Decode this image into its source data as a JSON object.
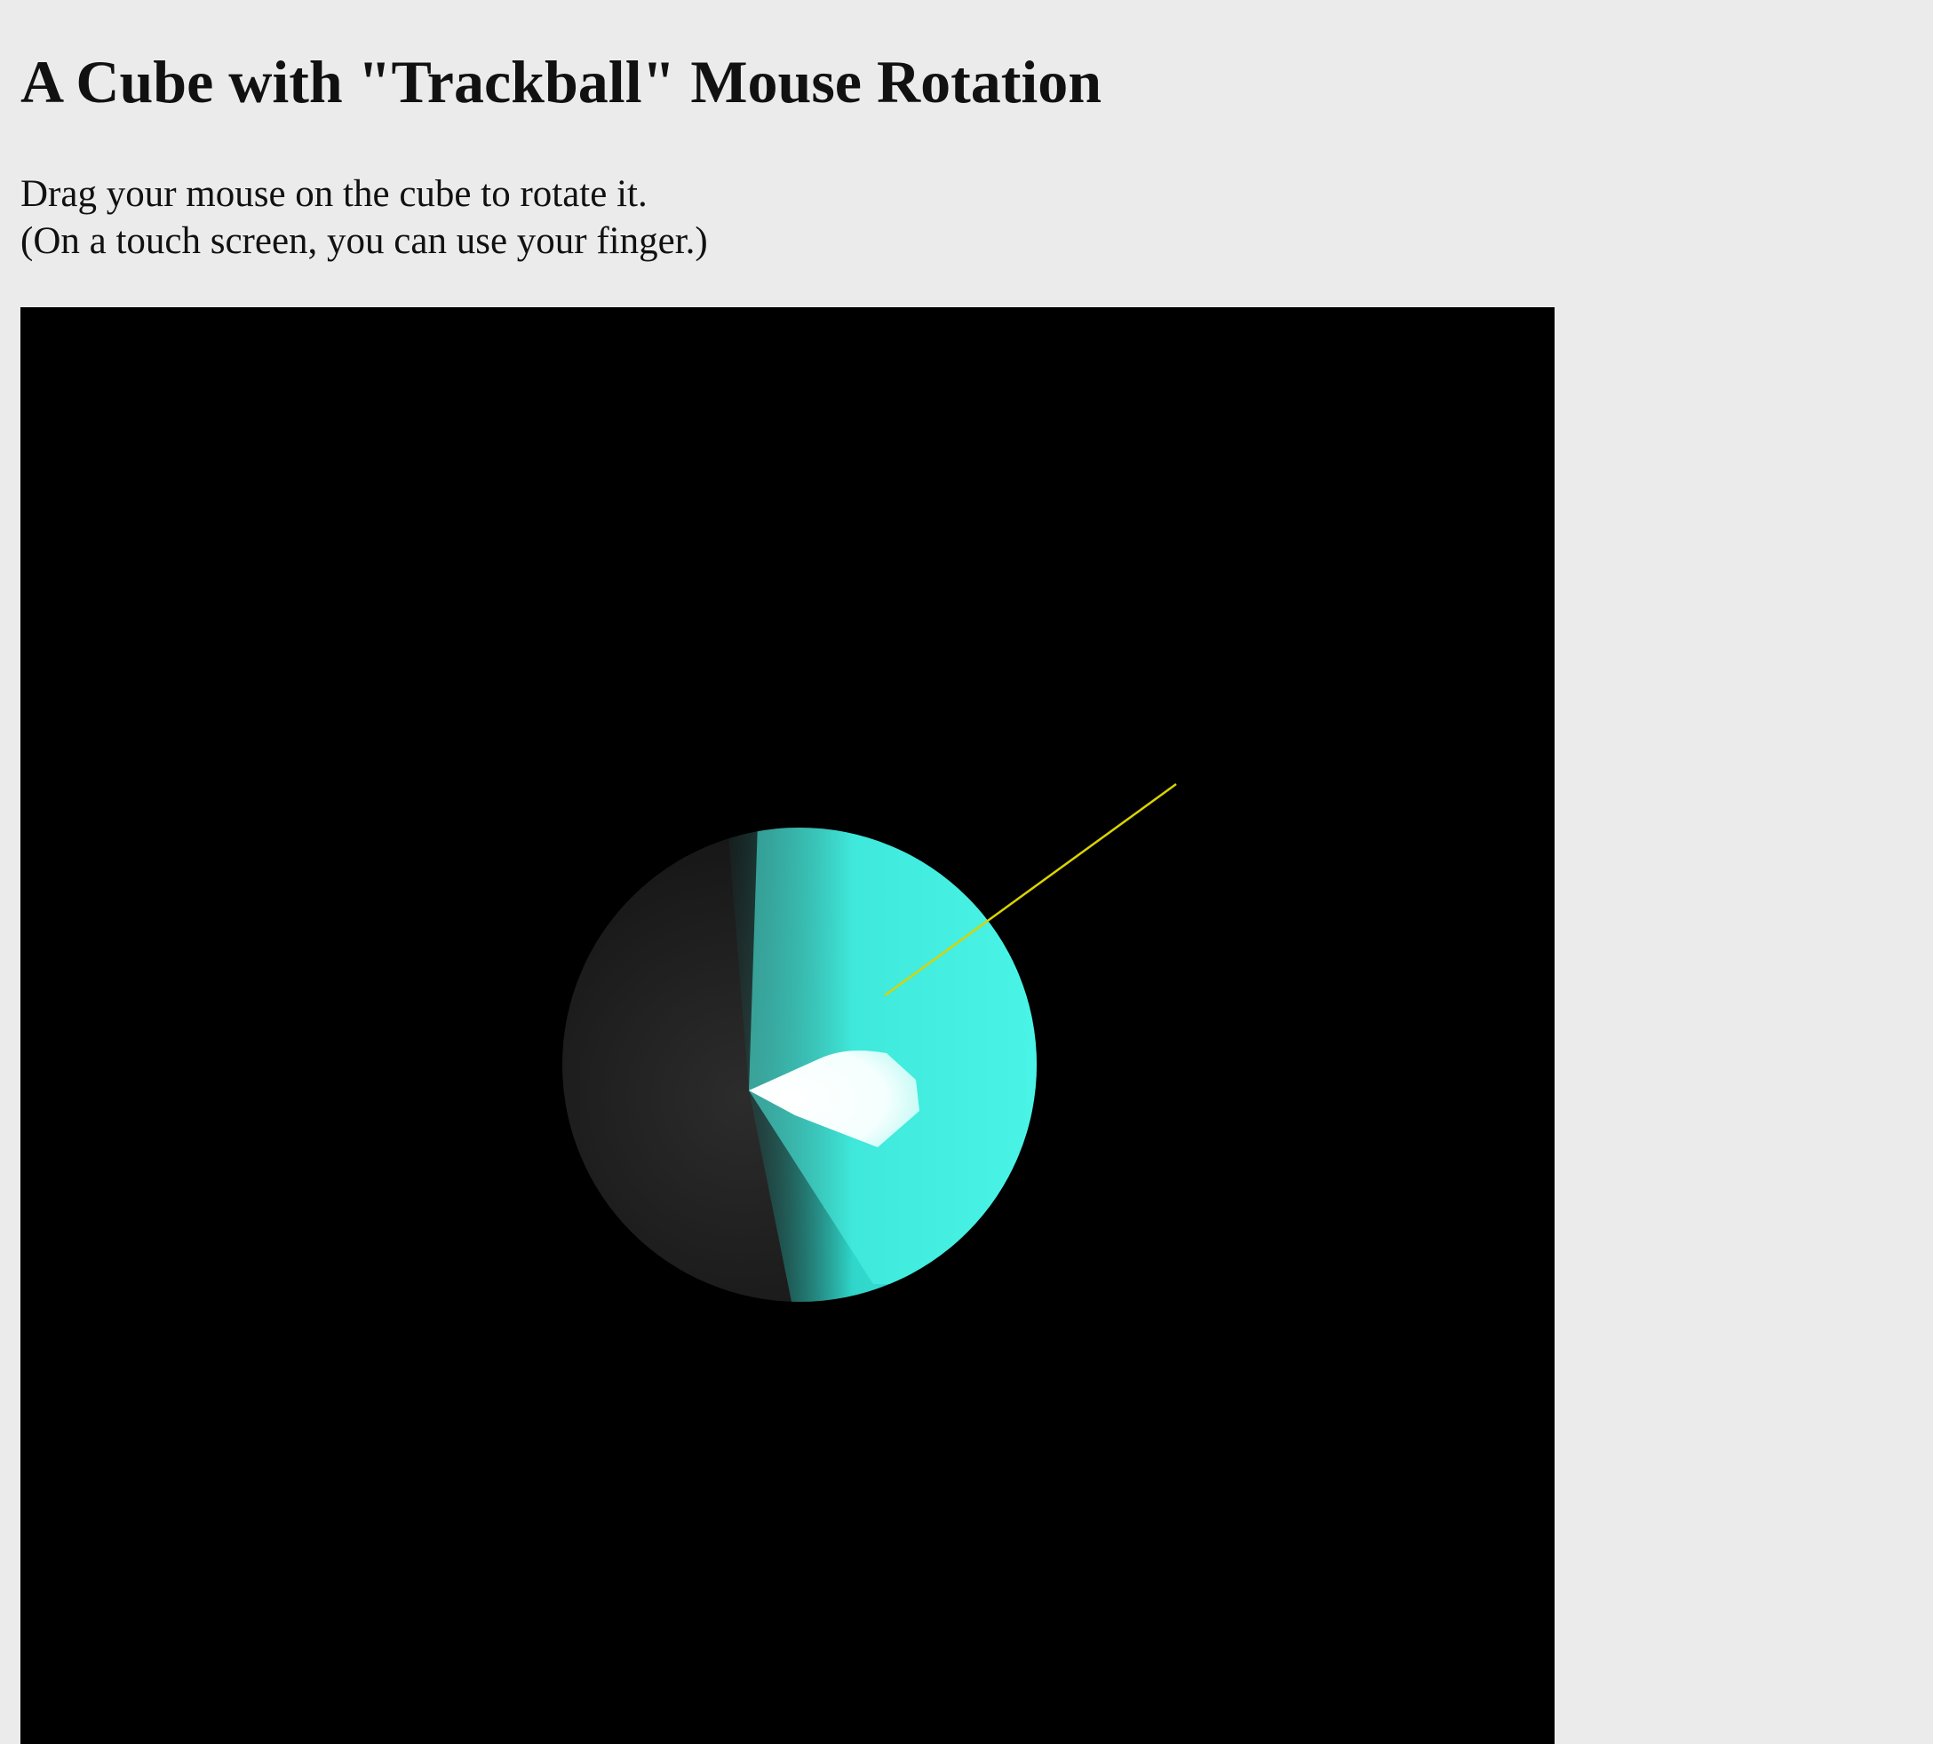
{
  "page": {
    "title": "A Cube with \"Trackball\" Mouse Rotation",
    "instructions": [
      "Drag your mouse on the cube to rotate it.",
      "(On a touch screen, you can use your finger.)"
    ]
  },
  "canvas": {
    "background_color": "#000000",
    "object_colors": {
      "dark_face": "#1b1b1b",
      "cyan_face": "#4cf7ea",
      "highlight": "#ffffff",
      "axis_line": "#d9d300"
    }
  }
}
